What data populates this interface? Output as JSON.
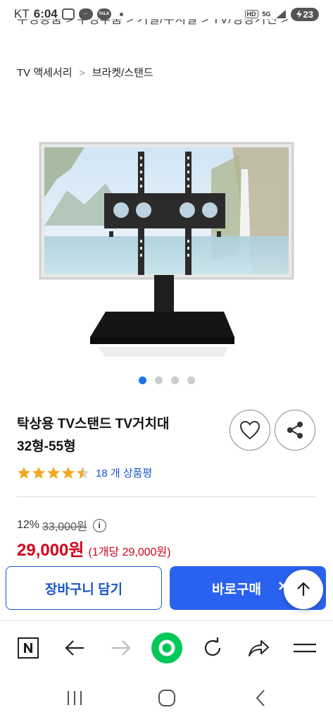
{
  "status_bar": {
    "carrier": "KT",
    "time": "6:04",
    "talk_label": "TALK",
    "hd_label": "HD",
    "network_label": "5G",
    "battery_level": "23"
  },
  "top_breadcrumb": "수정용품 > 수정부품 > 거실/수지실 > TV/영상기전 >",
  "breadcrumb": {
    "level1": "TV 액세서리",
    "separator": ">",
    "level2": "브라켓/스탠드"
  },
  "product": {
    "image_icon": "tv-stand-product-image",
    "image_count": 4,
    "active_image": 1,
    "title_line1": "탁상용 TV스탠드 TV거치대",
    "title_line2": "32형-55형",
    "rating": 4.5,
    "review_count": "18 개 상품평",
    "discount": "12%",
    "original_price": "33,000원",
    "info_symbol": "i",
    "sale_price": "29,000원",
    "unit_price": "(1개당 29,000원)"
  },
  "actions": {
    "cart_label": "장바구니 담기",
    "buy_label": "바로구매",
    "buy_close": "×",
    "wish_icon": "heart-icon",
    "share_icon": "share-icon",
    "top_icon": "arrow-up-icon"
  },
  "browser_toolbar": [
    "naver-n-icon",
    "back-arrow-icon",
    "forward-arrow-icon",
    "green-dot-icon",
    "refresh-icon",
    "share-arrow-icon",
    "menu-icon"
  ],
  "android_nav": [
    "recent-apps-icon",
    "home-icon",
    "back-icon"
  ],
  "colors": {
    "accent": "#2a62f0",
    "price_red": "#d0021b",
    "link_blue": "#1a56c4",
    "star": "#f5a623",
    "naver_green": "#03c75a"
  }
}
